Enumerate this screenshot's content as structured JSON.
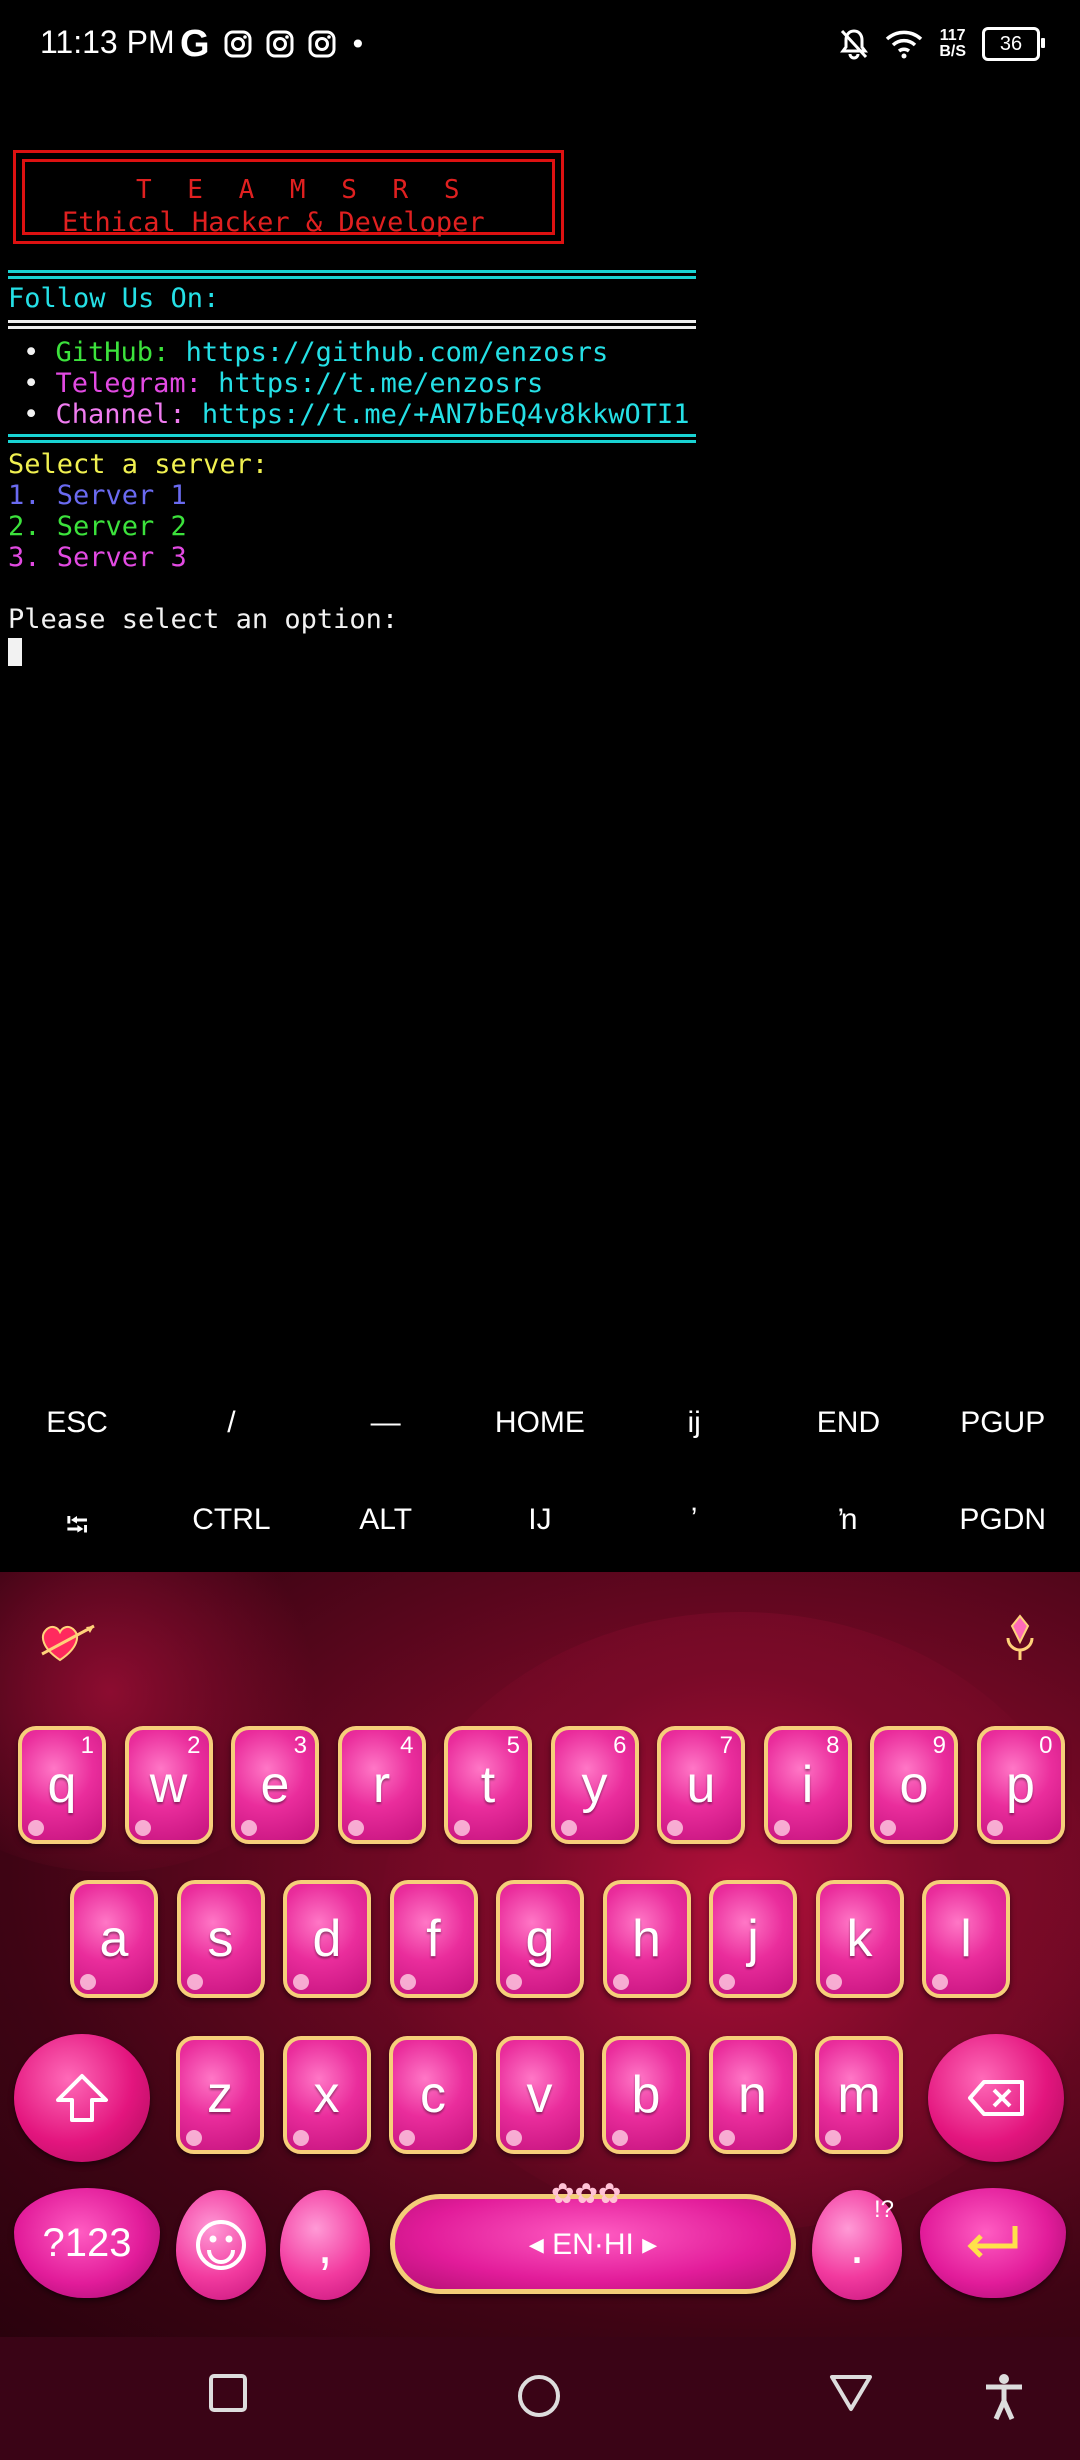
{
  "status_bar": {
    "time": "11:13 PM",
    "left_icons": [
      "google-icon",
      "instagram-icon",
      "instagram-icon",
      "instagram-icon",
      "dot-icon"
    ],
    "speed_top": "117",
    "speed_bottom": "B/S",
    "battery": "36"
  },
  "terminal": {
    "banner_title": "T E A M  S R S",
    "banner_subtitle": "Ethical Hacker & Developer",
    "follow_heading": "Follow Us On:",
    "links": [
      {
        "bullet": "•",
        "label": "GitHub:",
        "url": "https://github.com/enzosrs"
      },
      {
        "bullet": "•",
        "label": "Telegram:",
        "url": "https://t.me/enzosrs"
      },
      {
        "bullet": "•",
        "label": "Channel:",
        "url": "https://t.me/+AN7bEQ4v8kkwOTI1"
      }
    ],
    "select_heading": "Select a server:",
    "servers": [
      "1. Server 1",
      "2. Server 2",
      "3. Server 3"
    ],
    "prompt": "Please select an option:"
  },
  "extra_keys": {
    "row1": [
      "ESC",
      "/",
      "—",
      "HOME",
      "ij",
      "END",
      "PGUP"
    ],
    "row2": [
      "⭾",
      "CTRL",
      "ALT",
      "IJ",
      "ʼ",
      "ŉ",
      "PGDN"
    ]
  },
  "keyboard": {
    "row1": [
      {
        "ch": "q",
        "num": "1"
      },
      {
        "ch": "w",
        "num": "2"
      },
      {
        "ch": "e",
        "num": "3"
      },
      {
        "ch": "r",
        "num": "4"
      },
      {
        "ch": "t",
        "num": "5"
      },
      {
        "ch": "y",
        "num": "6"
      },
      {
        "ch": "u",
        "num": "7"
      },
      {
        "ch": "i",
        "num": "8"
      },
      {
        "ch": "o",
        "num": "9"
      },
      {
        "ch": "p",
        "num": "0"
      }
    ],
    "row2": [
      "a",
      "s",
      "d",
      "f",
      "g",
      "h",
      "j",
      "k",
      "l"
    ],
    "row3": [
      "z",
      "x",
      "c",
      "v",
      "b",
      "n",
      "m"
    ],
    "symbols_label": "?123",
    "comma_label": ",",
    "space_label": "◂ EN·HI ▸",
    "period_label": ".",
    "period_hint": "!?"
  }
}
